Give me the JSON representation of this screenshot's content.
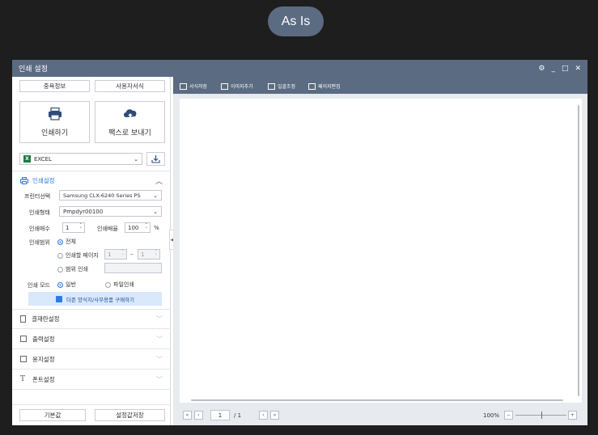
{
  "badge": "As Is",
  "window": {
    "title": "인쇄 설정",
    "controls": {
      "settings": "⚙",
      "minimize": "_",
      "maximize": "□",
      "close": "✕"
    }
  },
  "sidebar": {
    "top_buttons": [
      "중욕정보",
      "사용자서식"
    ],
    "print_button": "인쇄하기",
    "fax_button": "팩스로 보내기",
    "format": {
      "icon_letter": "X",
      "value": "EXCEL"
    },
    "print_settings": {
      "title": "인쇄설정",
      "printer_label": "프린터선택",
      "printer_value": "Samsung CLX-6240 Series PS",
      "form_label": "인쇄형태",
      "form_value": "Pmpdyr00100",
      "copies_label": "인쇄매수",
      "copies_value": "1",
      "scale_label": "인쇄배율",
      "scale_value": "100",
      "scale_unit": "%",
      "range_label": "인쇄범위",
      "range_all": "전체",
      "range_pages": "인쇄할 페이지",
      "page_from": "1",
      "page_dash": "–",
      "page_to": "1",
      "range_selection": "범위 인쇄",
      "mode_label": "인쇄 모드",
      "mode_normal": "일반",
      "mode_file": "파일인쇄",
      "purchase_button": "더존 양식지/사무용품 구매하기"
    },
    "sections": [
      {
        "label": "결재란설정",
        "icon": "document-icon"
      },
      {
        "label": "출력설정",
        "icon": "list-icon"
      },
      {
        "label": "용지설정",
        "icon": "paper-icon"
      },
      {
        "label": "폰트설정",
        "icon": "font-icon"
      }
    ],
    "bottom_buttons": [
      "기본값",
      "설정값저장"
    ]
  },
  "toolbar": {
    "items": [
      "서식저장",
      "이미지추가",
      "일괄조정",
      "페이지편집"
    ]
  },
  "footer": {
    "page_current": "1",
    "page_total": "/ 1",
    "zoom": "100%",
    "zoom_level": 0.5
  },
  "colors": {
    "titlebar": "#5b6b82",
    "accent": "#2e7be6",
    "badge": "#5b6b82",
    "excel": "#1f7a3f"
  }
}
